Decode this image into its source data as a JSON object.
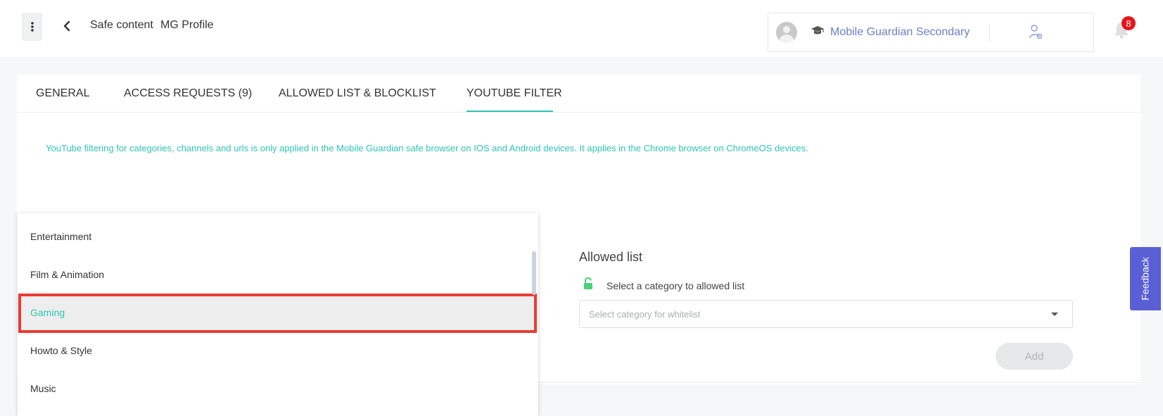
{
  "header": {
    "breadcrumb": [
      "Safe content",
      "MG Profile"
    ],
    "school_name": "Mobile Guardian Secondary",
    "notification_count": "8"
  },
  "tabs": [
    {
      "label": "GENERAL"
    },
    {
      "label": "ACCESS REQUESTS (9)"
    },
    {
      "label": "ALLOWED LIST & BLOCKLIST"
    },
    {
      "label": "YOUTUBE FILTER"
    }
  ],
  "notice": "YouTube filtering for categories, channels and urls is only applied in the Mobile Guardian safe browser on IOS and Android devices. It applies in the Chrome browser on ChromeOS devices.",
  "allowed": {
    "title": "Allowed list",
    "subtitle": "Select a category to allowed list",
    "select_placeholder": "Select category for whitelist",
    "add_label": "Add"
  },
  "dropdown": {
    "items": [
      "Entertainment",
      "Film & Animation",
      "Gaming",
      "Howto & Style",
      "Music"
    ],
    "highlighted": "Gaming"
  },
  "feedback_label": "Feedback",
  "colors": {
    "accent": "#2ec4b6",
    "link": "#6b7fc6",
    "badge": "#e8141c",
    "highlight_border": "#ea3b35",
    "feedback": "#5b5fd6"
  }
}
